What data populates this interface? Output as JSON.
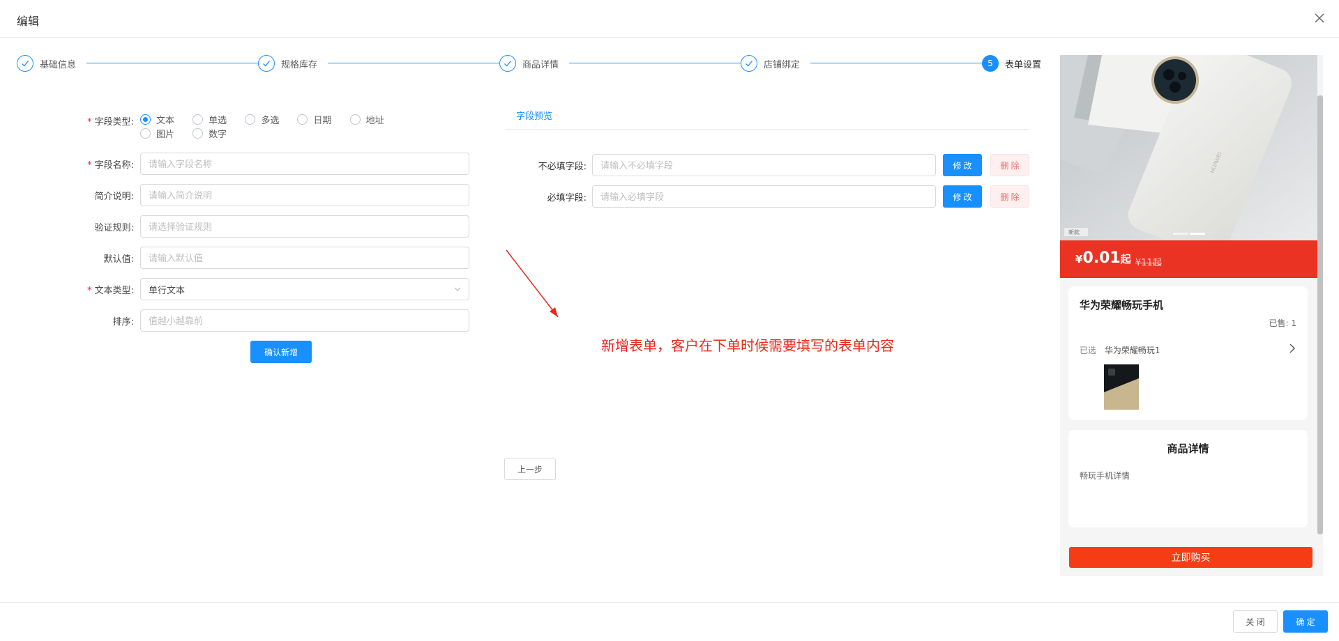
{
  "dialog": {
    "title": "编辑"
  },
  "steps": [
    {
      "label": "基础信息",
      "state": "done"
    },
    {
      "label": "规格库存",
      "state": "done"
    },
    {
      "label": "商品详情",
      "state": "done"
    },
    {
      "label": "店铺绑定",
      "state": "done"
    },
    {
      "label": "表单设置",
      "state": "active",
      "number": "5"
    }
  ],
  "form": {
    "field_type": {
      "label": "字段类型:",
      "options": [
        "文本",
        "单选",
        "多选",
        "日期",
        "地址",
        "图片",
        "数字"
      ],
      "selected": "文本"
    },
    "field_name": {
      "label": "字段名称:",
      "placeholder": "请输入字段名称"
    },
    "description": {
      "label": "简介说明:",
      "placeholder": "请输入简介说明"
    },
    "validation": {
      "label": "验证规则:",
      "placeholder": "请选择验证规则"
    },
    "default_value": {
      "label": "默认值:",
      "placeholder": "请输入默认值"
    },
    "text_type": {
      "label": "文本类型:",
      "value": "单行文本"
    },
    "sort": {
      "label": "排序:",
      "placeholder": "值越小越靠前"
    },
    "confirm_add": "确认新增"
  },
  "preview": {
    "tab": "字段预览",
    "fields": [
      {
        "label": "不必填字段:",
        "placeholder": "请输入不必填字段",
        "edit": "修 改",
        "delete": "删 除"
      },
      {
        "label": "必填字段:",
        "placeholder": "请输入必填字段",
        "edit": "修 改",
        "delete": "删 除"
      }
    ]
  },
  "annotation": "新增表单，客户在下单时候需要填写的表单内容",
  "prev_step": "上一步",
  "phone": {
    "hero_badge": "新款",
    "hero_brand": "HUAWEI",
    "price_symbol": "¥",
    "price": "0.01",
    "price_suffix": "起",
    "original_price": "¥11起",
    "product_name": "华为荣耀畅玩手机",
    "sold": "已售: 1",
    "selected_label": "已选",
    "selected_value": "华为荣耀畅玩1",
    "detail_title": "商品详情",
    "detail_text": "畅玩手机详情",
    "buy_now": "立即购买"
  },
  "footer": {
    "close": "关 闭",
    "confirm": "确 定"
  },
  "colors": {
    "primary": "#1890ff",
    "danger": "#f56c6c",
    "price_bar": "#ea3323",
    "buy": "#f53c14",
    "annotation": "#e8281c"
  }
}
